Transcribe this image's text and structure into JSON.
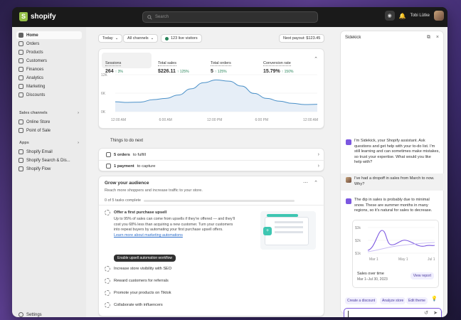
{
  "brand": {
    "name": "shopify"
  },
  "topbar": {
    "search_placeholder": "Search",
    "store_name": "Tobi Lütke"
  },
  "sidebar": {
    "items": [
      {
        "label": "Home",
        "icon": "home-icon",
        "active": true
      },
      {
        "label": "Orders",
        "icon": "orders-icon"
      },
      {
        "label": "Products",
        "icon": "products-icon"
      },
      {
        "label": "Customers",
        "icon": "customers-icon"
      },
      {
        "label": "Finances",
        "icon": "finances-icon"
      },
      {
        "label": "Analytics",
        "icon": "analytics-icon"
      },
      {
        "label": "Marketing",
        "icon": "marketing-icon"
      },
      {
        "label": "Discounts",
        "icon": "discounts-icon"
      }
    ],
    "channels_heading": "Sales channels",
    "channels": [
      {
        "label": "Online Store",
        "icon": "store-icon"
      },
      {
        "label": "Point of Sale",
        "icon": "pos-icon"
      }
    ],
    "apps_heading": "Apps",
    "apps": [
      {
        "label": "Shopify Email",
        "icon": "email-icon"
      },
      {
        "label": "Shopify Search & Dis...",
        "icon": "search-discovery-icon"
      },
      {
        "label": "Shopify Flow",
        "icon": "flow-icon"
      }
    ],
    "settings": "Settings"
  },
  "filters": {
    "date": "Today",
    "channels": "All channels",
    "live": "123 live visitors",
    "payout": "Next payout: $123.45"
  },
  "metrics": [
    {
      "label": "Sessions",
      "value": "264",
      "delta": "↑ 3%"
    },
    {
      "label": "Total sales",
      "value": "$226.11",
      "delta": "↑ 125%"
    },
    {
      "label": "Total orders",
      "value": "5",
      "delta": "↑ 125%"
    },
    {
      "label": "Conversion rate",
      "value": "15.79%",
      "delta": "↑ 150%"
    }
  ],
  "chart_data": {
    "type": "area",
    "x": [
      "12:00 AM",
      "6:00 AM",
      "12:00 PM",
      "6:00 PM",
      "12:00 AM"
    ],
    "y_ticks": [
      "12K",
      "6K",
      "0K"
    ],
    "ylim": [
      0,
      12000
    ],
    "series": [
      {
        "values": [
          3200,
          3000,
          3100,
          3900,
          4300,
          5400,
          7400,
          9400,
          10300,
          9900,
          8300,
          5900,
          4300,
          3400,
          2700,
          2300,
          2400
        ]
      }
    ]
  },
  "todo": {
    "heading": "Things to do next",
    "items": [
      {
        "count": "5 orders",
        "text": "to fulfill"
      },
      {
        "count": "1 payment",
        "text": "to capture"
      }
    ]
  },
  "grow": {
    "title": "Grow your audience",
    "subtitle": "Reach more shoppers and increase traffic to your store.",
    "progress_text": "0 of 5 tasks complete",
    "progress": 0,
    "first_task": {
      "title": "Offer a first purchase upsell",
      "body": [
        "Up to 95% of sales can come from upsells if they're offered — and they'll",
        "cost you 68% less than acquiring a new customer. Turn your customers",
        "into repeat buyers by automating your first purchase upsell offers."
      ],
      "link": "Learn more about marketing automations",
      "button": "Enable upsell automation workflow"
    },
    "tasks": [
      "Increase store visibility with SEO",
      "Reward customers for referrals",
      "Promote your products on Tiktok",
      "Collaborate with influencers"
    ]
  },
  "sidekick": {
    "title": "Sidekick",
    "intro": [
      "I'm Sidekick, your Shopify assistant. Ask",
      "questions and get help with your to-do list. I'm",
      "still learning and can sometimes make mistakes,",
      "so trust your expertise. What would you like",
      "help with?"
    ],
    "user_msg": [
      "I've had a dropoff in sales from March to now.",
      "Why?"
    ],
    "reply": [
      "The dip in sales is probably due to minimal",
      "snow. These are summer months in many",
      "regions, so it's natural for sales to decrease."
    ],
    "mini_chart": {
      "type": "line",
      "y_ticks": [
        "$3k",
        "$2k",
        "$1k"
      ],
      "x_ticks": [
        "Mar 1",
        "May 1",
        "Jul 1"
      ],
      "caption": "Sales over time",
      "range": "Mar 1–Jul 30, 2023",
      "button": "View report"
    },
    "chips": [
      "Create a discount",
      "Analyze store",
      "Edit theme"
    ]
  },
  "colors": {
    "accent": "#7b57e0",
    "positive": "#29845a",
    "chart_line": "#4a90c8"
  }
}
